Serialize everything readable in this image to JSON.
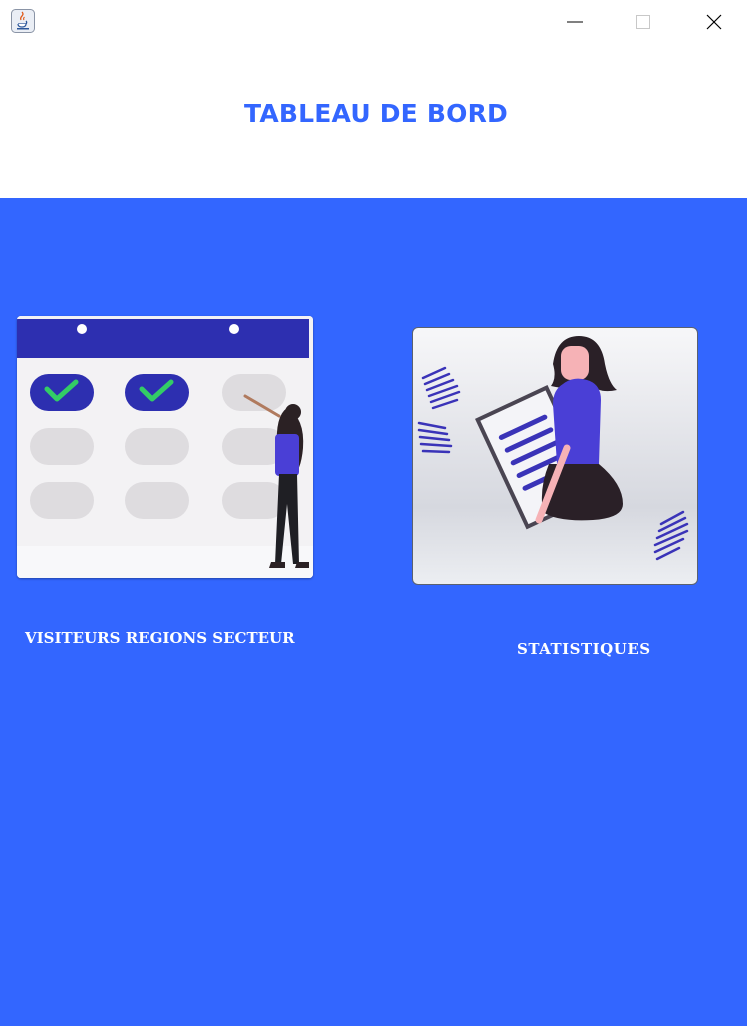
{
  "window": {
    "app_icon": "java-icon",
    "controls": [
      "minimize-icon",
      "maximize-icon",
      "close-icon"
    ]
  },
  "header": {
    "title": "TABLEAU DE BORD"
  },
  "tiles": [
    {
      "label": "VISITEURS REGIONS SECTEUR",
      "illustration": "calendar-illustration"
    },
    {
      "label": "STATISTIQUES",
      "illustration": "statistics-illustration"
    }
  ],
  "colors": {
    "accent": "#3366ff",
    "background": "#ffffff",
    "label_text": "#ffffff",
    "calendar_header": "#2d2fb0",
    "check_green": "#33cc66"
  }
}
